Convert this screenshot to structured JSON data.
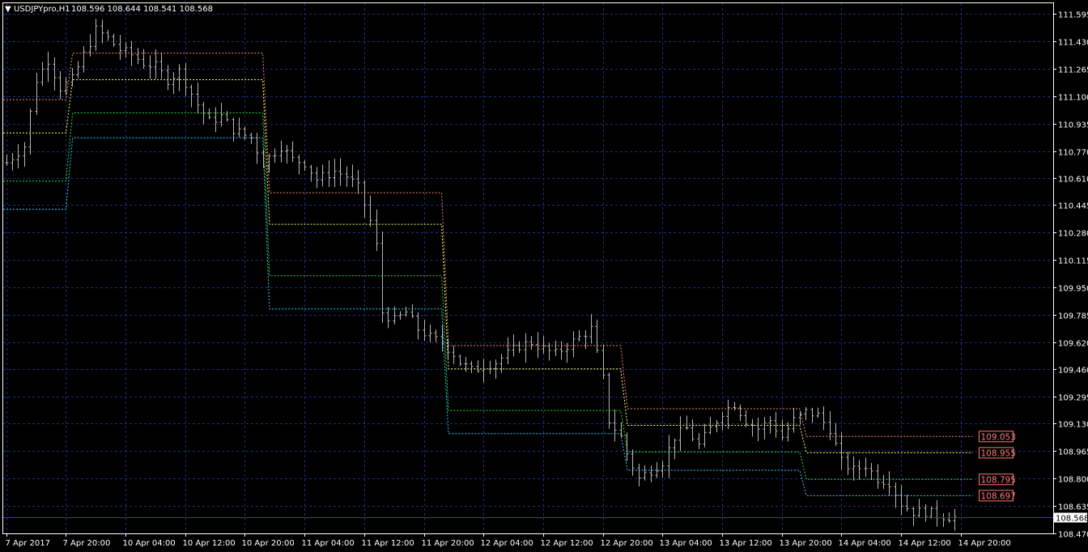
{
  "header": {
    "dropdown_glyph": "▼",
    "symbol": "USDJPYpro,H1",
    "ohlc": "108.596 108.644 108.541 108.568"
  },
  "colors": {
    "background": "#000000",
    "grid": "#1f2d7a",
    "bar": "#b8b8b8",
    "axis_text": "#ffffff",
    "price_line": "#2e3f9e",
    "current_price_bg": "#ffffff",
    "level_label": "#ff7a7a",
    "series_colors": [
      "#f08a70",
      "#ffff66",
      "#33dd33",
      "#33ccff"
    ]
  },
  "chart_data": {
    "type": "line",
    "subtype": "ohlc-bars-with-stepped-levels",
    "title": "",
    "xlabel": "",
    "ylabel": "",
    "ylim": [
      108.47,
      111.66
    ],
    "xlim_bars": [
      -0.5,
      175.5
    ],
    "grid": true,
    "y_ticks": [
      "111.595",
      "111.430",
      "111.265",
      "111.100",
      "110.935",
      "110.770",
      "110.610",
      "110.445",
      "110.280",
      "110.115",
      "109.950",
      "109.785",
      "109.620",
      "109.460",
      "109.295",
      "109.130",
      "108.965",
      "108.800",
      "108.635",
      "108.470"
    ],
    "x_ticks": [
      {
        "bar": 0,
        "label": "7 Apr 2017"
      },
      {
        "bar": 10,
        "label": "7 Apr 20:00"
      },
      {
        "bar": 20,
        "label": "10 Apr 04:00"
      },
      {
        "bar": 30,
        "label": "10 Apr 12:00"
      },
      {
        "bar": 40,
        "label": "10 Apr 20:00"
      },
      {
        "bar": 50,
        "label": "11 Apr 04:00"
      },
      {
        "bar": 60,
        "label": "11 Apr 12:00"
      },
      {
        "bar": 70,
        "label": "11 Apr 20:00"
      },
      {
        "bar": 80,
        "label": "12 Apr 04:00"
      },
      {
        "bar": 90,
        "label": "12 Apr 12:00"
      },
      {
        "bar": 100,
        "label": "12 Apr 20:00"
      },
      {
        "bar": 110,
        "label": "13 Apr 04:00"
      },
      {
        "bar": 120,
        "label": "13 Apr 12:00"
      },
      {
        "bar": 130,
        "label": "13 Apr 20:00"
      },
      {
        "bar": 140,
        "label": "14 Apr 04:00"
      },
      {
        "bar": 150,
        "label": "14 Apr 12:00"
      },
      {
        "bar": 160,
        "label": "14 Apr 20:00"
      }
    ],
    "current_price": 108.568,
    "price_anchors": [
      [
        0,
        110.7
      ],
      [
        3,
        110.8
      ],
      [
        5,
        111.2
      ],
      [
        7,
        111.32
      ],
      [
        9,
        111.15
      ],
      [
        11,
        111.2
      ],
      [
        13,
        111.35
      ],
      [
        15,
        111.5
      ],
      [
        17,
        111.45
      ],
      [
        19,
        111.38
      ],
      [
        21,
        111.35
      ],
      [
        23,
        111.3
      ],
      [
        25,
        111.28
      ],
      [
        27,
        111.2
      ],
      [
        29,
        111.25
      ],
      [
        32,
        111.05
      ],
      [
        34,
        110.95
      ],
      [
        36,
        110.98
      ],
      [
        38,
        110.9
      ],
      [
        41,
        110.85
      ],
      [
        43,
        110.7
      ],
      [
        46,
        110.8
      ],
      [
        48,
        110.72
      ],
      [
        50,
        110.7
      ],
      [
        52,
        110.6
      ],
      [
        55,
        110.65
      ],
      [
        57,
        110.62
      ],
      [
        59,
        110.55
      ],
      [
        61,
        110.35
      ],
      [
        62,
        110.2
      ],
      [
        63,
        109.8
      ],
      [
        65,
        109.75
      ],
      [
        67,
        109.8
      ],
      [
        69,
        109.7
      ],
      [
        71,
        109.65
      ],
      [
        73,
        109.62
      ],
      [
        75,
        109.55
      ],
      [
        76,
        109.5
      ],
      [
        78,
        109.45
      ],
      [
        80,
        109.48
      ],
      [
        82,
        109.5
      ],
      [
        84,
        109.55
      ],
      [
        86,
        109.6
      ],
      [
        88,
        109.62
      ],
      [
        90,
        109.58
      ],
      [
        92,
        109.55
      ],
      [
        94,
        109.6
      ],
      [
        96,
        109.65
      ],
      [
        98,
        109.7
      ],
      [
        100,
        109.4
      ],
      [
        101,
        109.15
      ],
      [
        103,
        109.05
      ],
      [
        104,
        108.95
      ],
      [
        106,
        108.8
      ],
      [
        108,
        108.85
      ],
      [
        110,
        108.9
      ],
      [
        112,
        109.05
      ],
      [
        114,
        109.1
      ],
      [
        116,
        109.0
      ],
      [
        118,
        109.1
      ],
      [
        120,
        109.2
      ],
      [
        122,
        109.25
      ],
      [
        124,
        109.15
      ],
      [
        126,
        109.1
      ],
      [
        128,
        109.15
      ],
      [
        130,
        109.05
      ],
      [
        132,
        109.15
      ],
      [
        134,
        109.2
      ],
      [
        136,
        109.18
      ],
      [
        138,
        109.1
      ],
      [
        140,
        108.9
      ],
      [
        142,
        108.85
      ],
      [
        144,
        108.88
      ],
      [
        146,
        108.8
      ],
      [
        148,
        108.78
      ],
      [
        150,
        108.65
      ],
      [
        152,
        108.6
      ],
      [
        154,
        108.6
      ],
      [
        156,
        108.58
      ],
      [
        158,
        108.57
      ],
      [
        159,
        108.568
      ]
    ],
    "level_segments": [
      {
        "from": -1,
        "to": 10,
        "values": [
          111.08,
          110.88,
          110.59,
          110.42
        ]
      },
      {
        "from": 11,
        "to": 43,
        "values": [
          111.36,
          111.2,
          111.0,
          110.85
        ]
      },
      {
        "from": 44,
        "to": 73,
        "values": [
          110.52,
          110.33,
          110.02,
          109.82
        ]
      },
      {
        "from": 74,
        "to": 103,
        "values": [
          109.6,
          109.46,
          109.21,
          109.07
        ]
      },
      {
        "from": 104,
        "to": 133,
        "values": [
          109.22,
          109.12,
          108.96,
          108.85
        ]
      },
      {
        "from": 134,
        "to": 162,
        "values": [
          109.053,
          108.955,
          108.795,
          108.697
        ]
      }
    ],
    "level_labels": [
      "109.053",
      "108.955",
      "108.795",
      "108.697"
    ],
    "current_price_label": "108.568"
  }
}
